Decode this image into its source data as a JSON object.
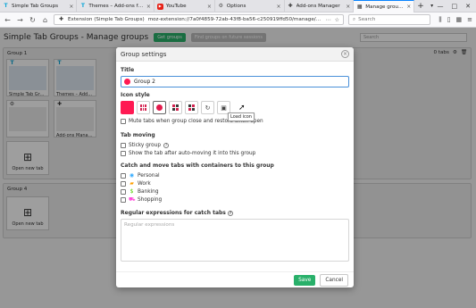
{
  "browser": {
    "tabs": [
      {
        "title": "Simple Tab Groups",
        "icon": "stg-icon",
        "active": false
      },
      {
        "title": "Themes – Add-ons for Firefox",
        "icon": "stg-icon",
        "active": false
      },
      {
        "title": "YouTube",
        "icon": "youtube-icon",
        "active": false
      },
      {
        "title": "Options",
        "icon": "gear-icon",
        "active": false
      },
      {
        "title": "Add-ons Manager",
        "icon": "puzzle-icon",
        "active": false
      },
      {
        "title": "Manage groups",
        "icon": "grid-icon",
        "active": true
      }
    ],
    "url_badge": "Extension (Simple Tab Groups)",
    "url": "moz-extension://7a0f4859-72ab-43f8-ba56-c250919ffd50/manage/manage.html",
    "search_placeholder": "Search"
  },
  "page": {
    "title": "Simple Tab Groups - Manage groups",
    "header_btn_1": "Get groups",
    "header_btn_2": "Find groups on future sessions",
    "search_placeholder": "Search",
    "group1": {
      "title": "Group 1",
      "tabs_count": "0 tabs",
      "thumbs": [
        "Simple Tab Groups – Firefox",
        "Themes – Add-ons",
        "",
        "Options",
        "Add-ons Manager",
        ""
      ],
      "new_tab_label": "Open new tab"
    },
    "group4": {
      "title": "Group 4",
      "new_tab_label": "Open new tab"
    }
  },
  "modal": {
    "header": "Group settings",
    "title_label": "Title",
    "title_value": "Group 2",
    "icon_style_label": "Icon style",
    "tooltip": "Load icon",
    "mute_label": "Mute tabs when group close and restore when open",
    "tab_moving_label": "Tab moving",
    "sticky_label": "Sticky group",
    "show_tab_label": "Show the tab after auto-moving it into this group",
    "containers_label": "Catch and move tabs with containers to this group",
    "containers": [
      {
        "name": "Personal",
        "icon": "fingerprint-icon",
        "color": "#37adff"
      },
      {
        "name": "Work",
        "icon": "briefcase-icon",
        "color": "#ff9f00"
      },
      {
        "name": "Banking",
        "icon": "dollar-icon",
        "color": "#51cd00"
      },
      {
        "name": "Shopping",
        "icon": "cart-icon",
        "color": "#ff4bda"
      }
    ],
    "regex_label": "Regular expressions for catch tabs",
    "regex_placeholder": "Regular expressions",
    "save_label": "Save",
    "cancel_label": "Cancel",
    "accent_color": "#ff1a53"
  }
}
